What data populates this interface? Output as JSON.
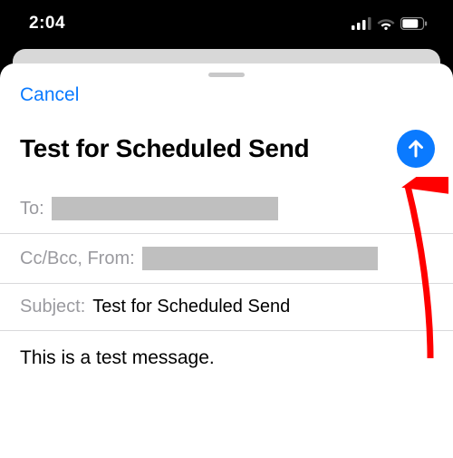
{
  "status": {
    "time": "2:04"
  },
  "compose": {
    "cancel_label": "Cancel",
    "title": "Test for Scheduled Send",
    "to_label": "To:",
    "ccbcc_label": "Cc/Bcc, From:",
    "subject_label": "Subject:",
    "subject_value": "Test for Scheduled Send",
    "body": "This is a test message."
  }
}
